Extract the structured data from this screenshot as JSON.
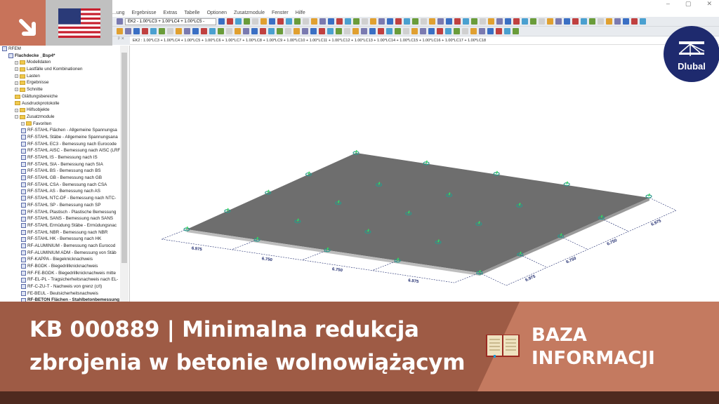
{
  "menu": [
    "...ung",
    "Ergebnisse",
    "Extras",
    "Tabelle",
    "Optionen",
    "Zusatzmodule",
    "Fenster",
    "Hilfe"
  ],
  "toolbar": {
    "load_combo": "EK2 - 1.00*LC3 + 1.00*LC4 + 1.00*LC5 -"
  },
  "window_controls": {
    "minimize": "–",
    "restore": "▢",
    "close": "✕"
  },
  "panel_controls": "ᵖ ×",
  "load_combination": "EK2 : 1.00*LC3 + 1.00*LC4 + 1.00*LC5 + 1.00*LC6 + 1.00*LC7 + 1.00*LC8 + 1.00*LC9 + 1.00*LC10 + 1.00*LC11 + 1.00*LC12 + 1.00*LC13 + 1.00*LC14 + 1.00*LC15 + 1.00*LC16 + 1.00*LC17 + 1.00*LC18",
  "tree": [
    {
      "label": "RFEM",
      "level": 0,
      "type": "root"
    },
    {
      "label": "Flachdecke _Bsp4*",
      "level": 1,
      "type": "model",
      "bold": true
    },
    {
      "label": "Modelldaten",
      "level": 2,
      "type": "folder"
    },
    {
      "label": "Lastfälle und Kombinationen",
      "level": 2,
      "type": "folder"
    },
    {
      "label": "Lasten",
      "level": 2,
      "type": "folder"
    },
    {
      "label": "Ergebnisse",
      "level": 2,
      "type": "folder"
    },
    {
      "label": "Schnitte",
      "level": 2,
      "type": "folder"
    },
    {
      "label": "Glättungsbereiche",
      "level": 2,
      "type": "folder"
    },
    {
      "label": "Ausdruckprotokolle",
      "level": 2,
      "type": "folder"
    },
    {
      "label": "Hilfsobjekte",
      "level": 2,
      "type": "folder"
    },
    {
      "label": "Zusatzmodule",
      "level": 2,
      "type": "folder"
    },
    {
      "label": "Favoriten",
      "level": 3,
      "type": "folder"
    },
    {
      "label": "RF-STAHL Flächen - Allgemeine Spannungsa",
      "level": 3,
      "type": "module"
    },
    {
      "label": "RF-STAHL Stäbe - Allgemeine Spannungsana",
      "level": 3,
      "type": "module"
    },
    {
      "label": "RF-STAHL EC3 - Bemessung nach Eurocode",
      "level": 3,
      "type": "module"
    },
    {
      "label": "RF-STAHL AISC - Bemessung nach AISC (LRF",
      "level": 3,
      "type": "module"
    },
    {
      "label": "RF-STAHL IS - Bemessung nach IS",
      "level": 3,
      "type": "module"
    },
    {
      "label": "RF-STAHL SIA - Bemessung nach SIA",
      "level": 3,
      "type": "module"
    },
    {
      "label": "RF-STAHL BS - Bemessung nach BS",
      "level": 3,
      "type": "module"
    },
    {
      "label": "RF-STAHL GB - Bemessung nach GB",
      "level": 3,
      "type": "module"
    },
    {
      "label": "RF-STAHL CSA - Bemessung nach CSA",
      "level": 3,
      "type": "module"
    },
    {
      "label": "RF-STAHL AS - Bemessung nach AS",
      "level": 3,
      "type": "module"
    },
    {
      "label": "RF-STAHL NTC-DF - Bemessung nach NTC-",
      "level": 3,
      "type": "module"
    },
    {
      "label": "RF-STAHL SP - Bemessung nach SP",
      "level": 3,
      "type": "module"
    },
    {
      "label": "RF-STAHL Plastisch - Plastische Bemessung",
      "level": 3,
      "type": "module"
    },
    {
      "label": "RF-STAHL SANS - Bemessung nach SANS",
      "level": 3,
      "type": "module"
    },
    {
      "label": "RF-STAHL Ermüdung Stäbe - Ermüdungsnac",
      "level": 3,
      "type": "module"
    },
    {
      "label": "RF-STAHL NBR - Bemessung nach NBR",
      "level": 3,
      "type": "module"
    },
    {
      "label": "RF-STAHL HK - Bemessung nach HK",
      "level": 3,
      "type": "module"
    },
    {
      "label": "RF-ALUMINIUM - Bemessung nach Eurocod",
      "level": 3,
      "type": "module"
    },
    {
      "label": "RF-ALUMINIUM ADM - Bemessung von Stäb",
      "level": 3,
      "type": "module"
    },
    {
      "label": "RF-KAPPA - Biegeknicknachweis",
      "level": 3,
      "type": "module"
    },
    {
      "label": "RF-BGDK - Biegedrillknicknachweis",
      "level": 3,
      "type": "module"
    },
    {
      "label": "RF-FE-BGDK - Biegedrillknicknachweis mitte",
      "level": 3,
      "type": "module"
    },
    {
      "label": "RF-EL-PL - Tragsicherheitsnachweis nach EL-",
      "level": 3,
      "type": "module"
    },
    {
      "label": "RF-C-ZU-T - Nachweis von grenz (c/t)",
      "level": 3,
      "type": "module"
    },
    {
      "label": "FE-BEUL - Beulsicherheitsnachweis",
      "level": 3,
      "type": "module"
    },
    {
      "label": "RF-BETON Flächen - Stahlbetonbemessung",
      "level": 3,
      "type": "module",
      "bold": true
    }
  ],
  "dimensions": {
    "front": [
      "6.975",
      "6.750",
      "6.750",
      "6.975"
    ],
    "side": [
      "6.975",
      "6.750",
      "6.750",
      "6.975"
    ]
  },
  "logo": "Dlubal",
  "banner": {
    "title_line1": "KB 000889 | Minimalna redukcja",
    "title_line2": "zbrojenia w betonie wolnowiążącym",
    "category_line1": "BAZA",
    "category_line2": "INFORMACJI"
  },
  "colors": {
    "accent": "#c8735a",
    "banner_dark": "#9e5b45",
    "banner_light": "#c47a60",
    "footer": "#4f2a1f",
    "logo": "#1e2a6e",
    "plate": "#6e6e6e"
  }
}
